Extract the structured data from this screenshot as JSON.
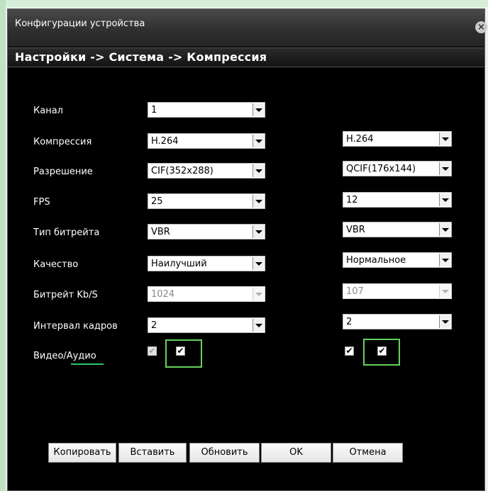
{
  "window": {
    "title": "Конфигурации устройства",
    "close_icon": "×"
  },
  "breadcrumb": "Настройки -> Система -> Компрессия",
  "labels": {
    "channel": "Канал",
    "compression": "Компрессия",
    "resolution": "Разрешение",
    "fps": "FPS",
    "bitrate_type": "Тип битрейта",
    "quality": "Качество",
    "bitrate": "Битрейт Kb/S",
    "frame_interval": "Интервал кадров",
    "video_audio_video": "Видео/",
    "video_audio_audio": "Аудио"
  },
  "main": {
    "channel": "1",
    "compression": "H.264",
    "resolution": "CIF(352x288)",
    "fps": "25",
    "bitrate_type": "VBR",
    "quality": "Наилучший",
    "bitrate": "1024",
    "frame_interval": "2",
    "video_checked": "✔",
    "audio_checked": "✔"
  },
  "extra": {
    "compression": "H.264",
    "resolution": "QCIF(176x144)",
    "fps": "12",
    "bitrate_type": "VBR",
    "quality": "Нормальное",
    "bitrate": "107",
    "frame_interval": "2",
    "video_checked": "✔",
    "audio_checked": "✔"
  },
  "buttons": {
    "copy": "Копировать",
    "paste": "Вставить",
    "refresh": "Обновить",
    "ok": "OK",
    "cancel": "Отмена"
  },
  "colors": {
    "highlight": "#63d35b",
    "underline": "#2fc46f",
    "background": "#000000"
  }
}
